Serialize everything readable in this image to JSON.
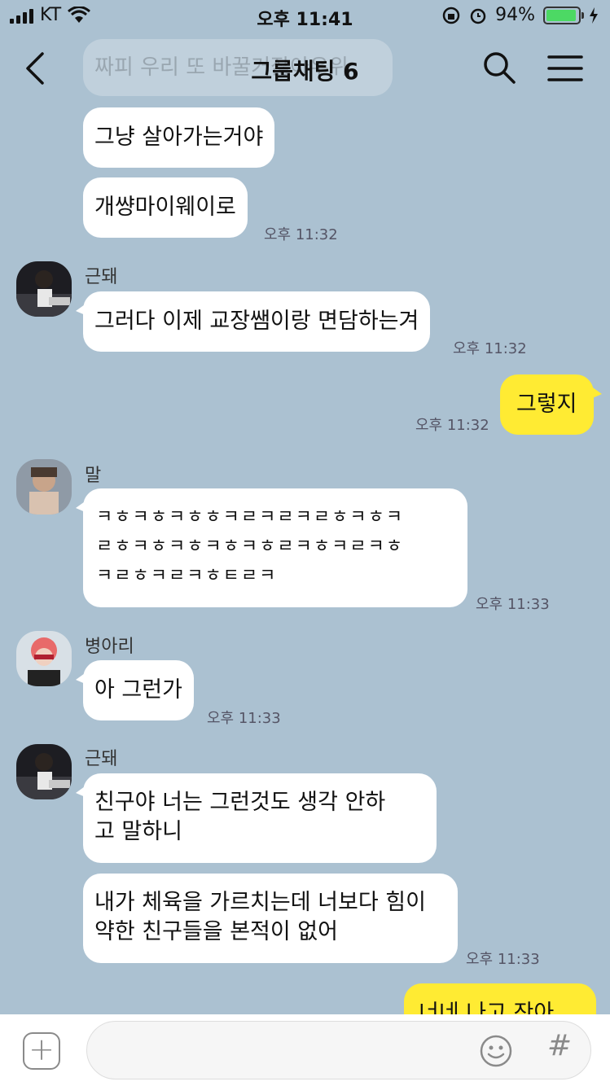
{
  "status_bar": {
    "carrier": "KT",
    "time": "오후 11:41",
    "battery_percent": "94%",
    "battery_level": 0.94,
    "battery_color": "#4cd964"
  },
  "header": {
    "back_icon": "chevron-left-icon",
    "title": "그룹채팅 6",
    "search_icon": "search-icon",
    "menu_icon": "hamburger-menu-icon"
  },
  "ghost_messages": [
    "짜피 우리 또 바꿀거잖아우위"
  ],
  "messages": [
    {
      "text": "그냥 살아가는거야"
    },
    {
      "text": "개썅마이웨이로",
      "time": "오후 11:32"
    },
    {
      "sender": "근돼",
      "text": "그러다 이제 교장쌤이랑 면담하는겨",
      "time": "오후 11:32"
    },
    {
      "mine": true,
      "text": "그렇지",
      "time": "오후 11:32"
    },
    {
      "sender": "말",
      "text": "ㅋㅎㅋㅎㅋㅎㅎㅋㄹㅋㄹㅋㄹㅎㅋㅎㅋ\nㄹㅎㅋㅎㅋㅎㅋㅎㅋㅎㄹㅋㅎㅋㄹㅋㅎ\nㅋㄹㅎㅋㄹㅋㅎㅌㄹㅋ",
      "time": "오후 11:33"
    },
    {
      "sender": "병아리",
      "text": "아 그런가",
      "time": "오후 11:33"
    },
    {
      "sender": "근돼",
      "text": "친구야 너는 그런것도 생각 안하\n고 말하니"
    },
    {
      "text": "내가 체육을 가르치는데 너보다 힘이\n약한 친구들을 본적이 없어",
      "time": "오후 11:33"
    },
    {
      "mine": true,
      "text": "너네 나고 잔아 .."
    }
  ],
  "input_bar": {
    "plus_icon": "plus-icon",
    "placeholder": "",
    "emoji_icon": "smiley-icon",
    "hash_label": "#"
  },
  "colors": {
    "background": "#abc1d1",
    "my_bubble": "#ffeb33",
    "other_bubble": "#ffffff"
  }
}
